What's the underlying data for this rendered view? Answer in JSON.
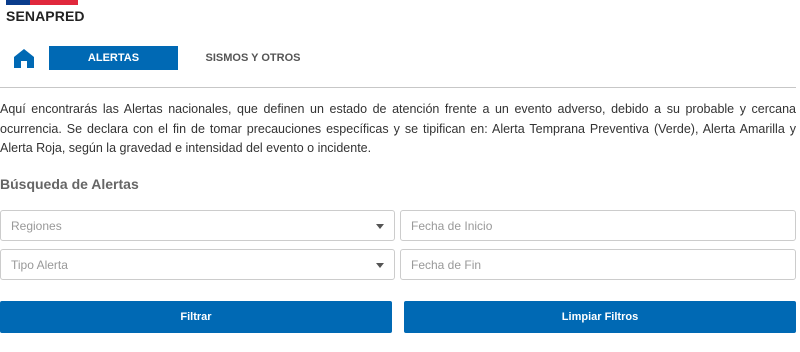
{
  "brand": {
    "name": "SENAPRED",
    "colors": {
      "blue": "#0a3c8c",
      "red": "#e0283c"
    }
  },
  "nav": {
    "home_icon": "home-icon",
    "tabs": [
      {
        "label": "ALERTAS",
        "active": true
      },
      {
        "label": "SISMOS Y OTROS",
        "active": false
      }
    ]
  },
  "intro": {
    "text": "Aquí encontrarás las Alertas nacionales, que definen un estado de atención frente a un evento adverso, debido a su probable y cercana ocurrencia. Se declara con el fin de tomar precauciones específicas y se tipifican en: Alerta Temprana Preventiva (Verde), Alerta Amarilla y Alerta Roja, según la gravedad e intensidad del evento o incidente."
  },
  "search": {
    "title": "Búsqueda de Alertas",
    "regiones_placeholder": "Regiones",
    "tipo_placeholder": "Tipo Alerta",
    "fecha_inicio_placeholder": "Fecha de Inicio",
    "fecha_fin_placeholder": "Fecha de Fin"
  },
  "actions": {
    "filter_label": "Filtrar",
    "clear_label": "Limpiar Filtros"
  },
  "theme": {
    "accent": "#0069b4"
  }
}
